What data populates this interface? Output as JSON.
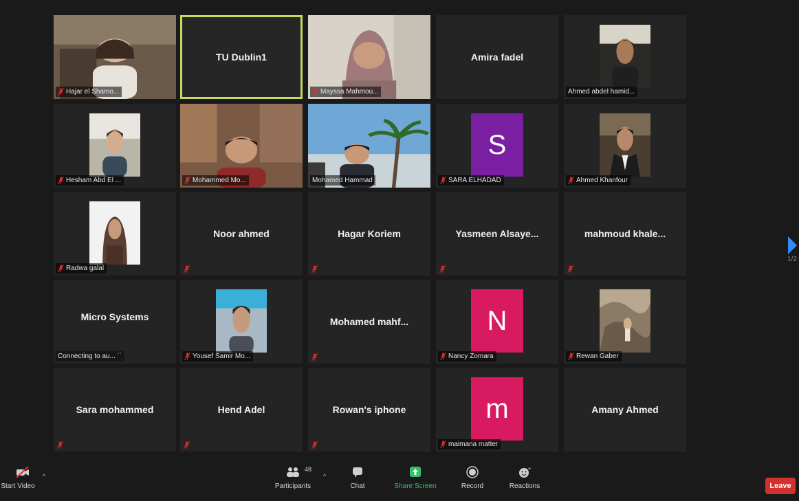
{
  "grid": {
    "tiles": [
      {
        "kind": "video",
        "name": "Hajar el Shamo...",
        "muted": true,
        "scene": "room-woman"
      },
      {
        "kind": "name",
        "name": "TU Dublin1",
        "muted": false,
        "active": true
      },
      {
        "kind": "video",
        "name": "Mayssa Mahmou...",
        "muted": true,
        "scene": "woman-hijab"
      },
      {
        "kind": "name",
        "name": "Amira fadel",
        "muted": false
      },
      {
        "kind": "photo",
        "name": "Ahmed abdel hamid...",
        "muted": false,
        "scene": "man-dark"
      },
      {
        "kind": "photo",
        "name": "Hesham Abd El ...",
        "muted": true,
        "scene": "man-light"
      },
      {
        "kind": "video",
        "name": "Mohammed Mo...",
        "muted": true,
        "scene": "man-room"
      },
      {
        "kind": "video",
        "name": "Mohamed Hammad",
        "muted": false,
        "scene": "beach"
      },
      {
        "kind": "avatar",
        "name": "SARA ELHADAD",
        "muted": true,
        "letter": "S",
        "color": "#7b1fa2"
      },
      {
        "kind": "photo",
        "name": "Ahmed Khanfour",
        "muted": true,
        "scene": "man-suit"
      },
      {
        "kind": "photo",
        "name": "Radwa galal",
        "muted": true,
        "scene": "woman-portrait"
      },
      {
        "kind": "name",
        "name": "Noor ahmed",
        "muted": true
      },
      {
        "kind": "name",
        "name": "Hagar Koriem",
        "muted": true
      },
      {
        "kind": "name",
        "name": "Yasmeen  Alsaye...",
        "muted": true
      },
      {
        "kind": "name",
        "name": "mahmoud  khale...",
        "muted": true
      },
      {
        "kind": "name",
        "name": "Micro Systems",
        "muted": false,
        "status": "Connecting to au... ˙˙"
      },
      {
        "kind": "photo",
        "name": "Yousef Samir Mo...",
        "muted": true,
        "scene": "man-blue"
      },
      {
        "kind": "name",
        "name": "Mohamed  mahf...",
        "muted": true
      },
      {
        "kind": "avatar",
        "name": "Nancy Zomara",
        "muted": true,
        "letter": "N",
        "color": "#d81b60"
      },
      {
        "kind": "photo",
        "name": "Rewan Gaber",
        "muted": true,
        "scene": "rocks"
      },
      {
        "kind": "name",
        "name": "Sara mohammed",
        "muted": true
      },
      {
        "kind": "name",
        "name": "Hend Adel",
        "muted": true
      },
      {
        "kind": "name",
        "name": "Rowan's iphone",
        "muted": true
      },
      {
        "kind": "avatar",
        "name": "maimana matter",
        "muted": true,
        "letter": "m",
        "color": "#d81b60"
      },
      {
        "kind": "name",
        "name": "Amany Ahmed",
        "muted": false
      }
    ]
  },
  "side": {
    "page_indicator": "1/2"
  },
  "toolbar": {
    "start_video": "Start Video",
    "participants": "Participants",
    "participants_count": "48",
    "chat": "Chat",
    "share_screen": "Share Screen",
    "record": "Record",
    "reactions": "Reactions",
    "leave": "Leave"
  },
  "colors": {
    "active_speaker": "#c6db5a",
    "leave": "#d0312d",
    "share": "#35c06a",
    "muted": "#e02d2d"
  }
}
